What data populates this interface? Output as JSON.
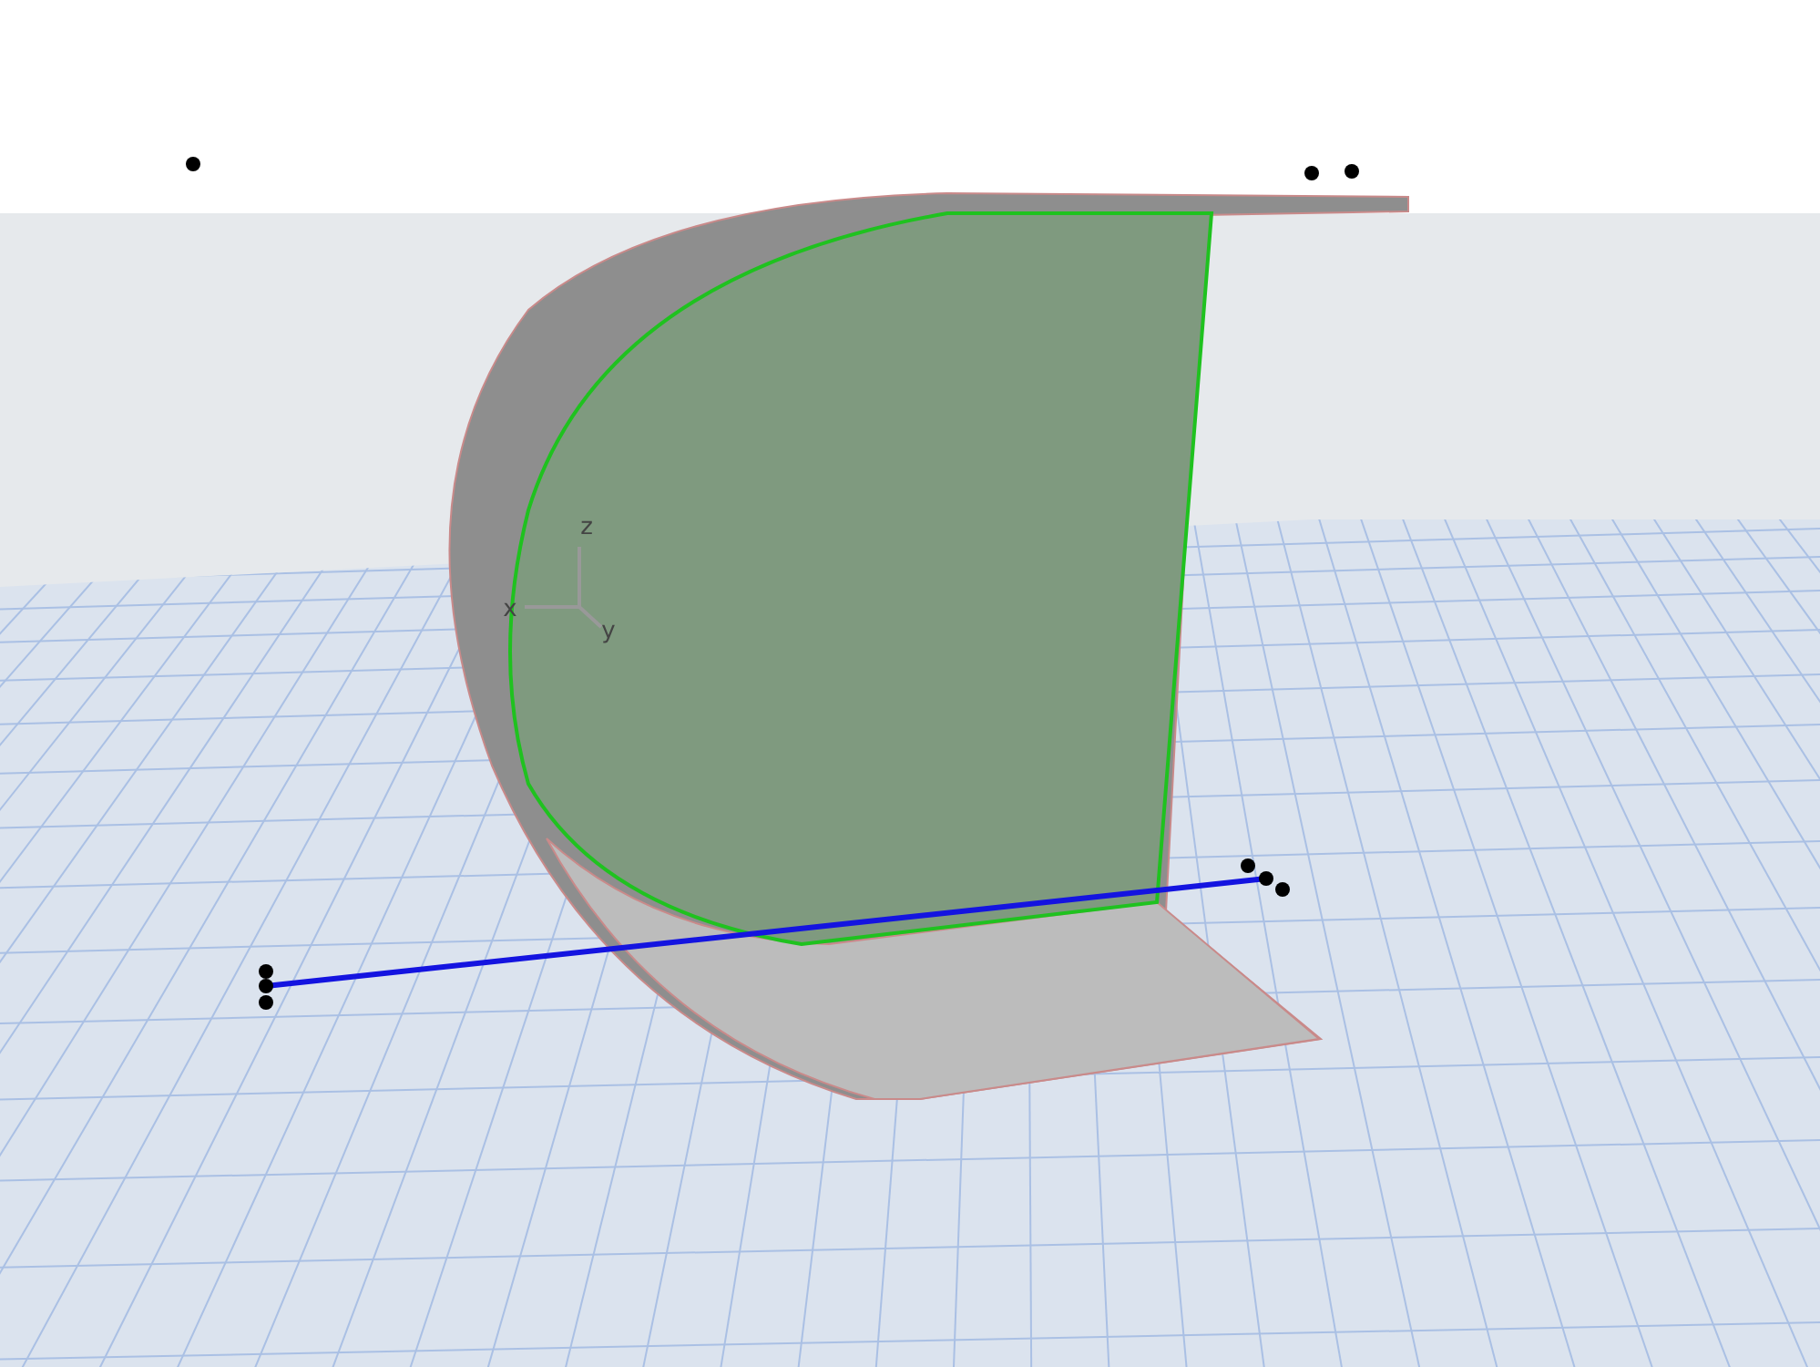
{
  "viewport": {
    "axis_labels": [
      {
        "kind": "z",
        "text": "z"
      },
      {
        "kind": "x",
        "text": "x"
      },
      {
        "kind": "y",
        "text": "y"
      }
    ]
  }
}
